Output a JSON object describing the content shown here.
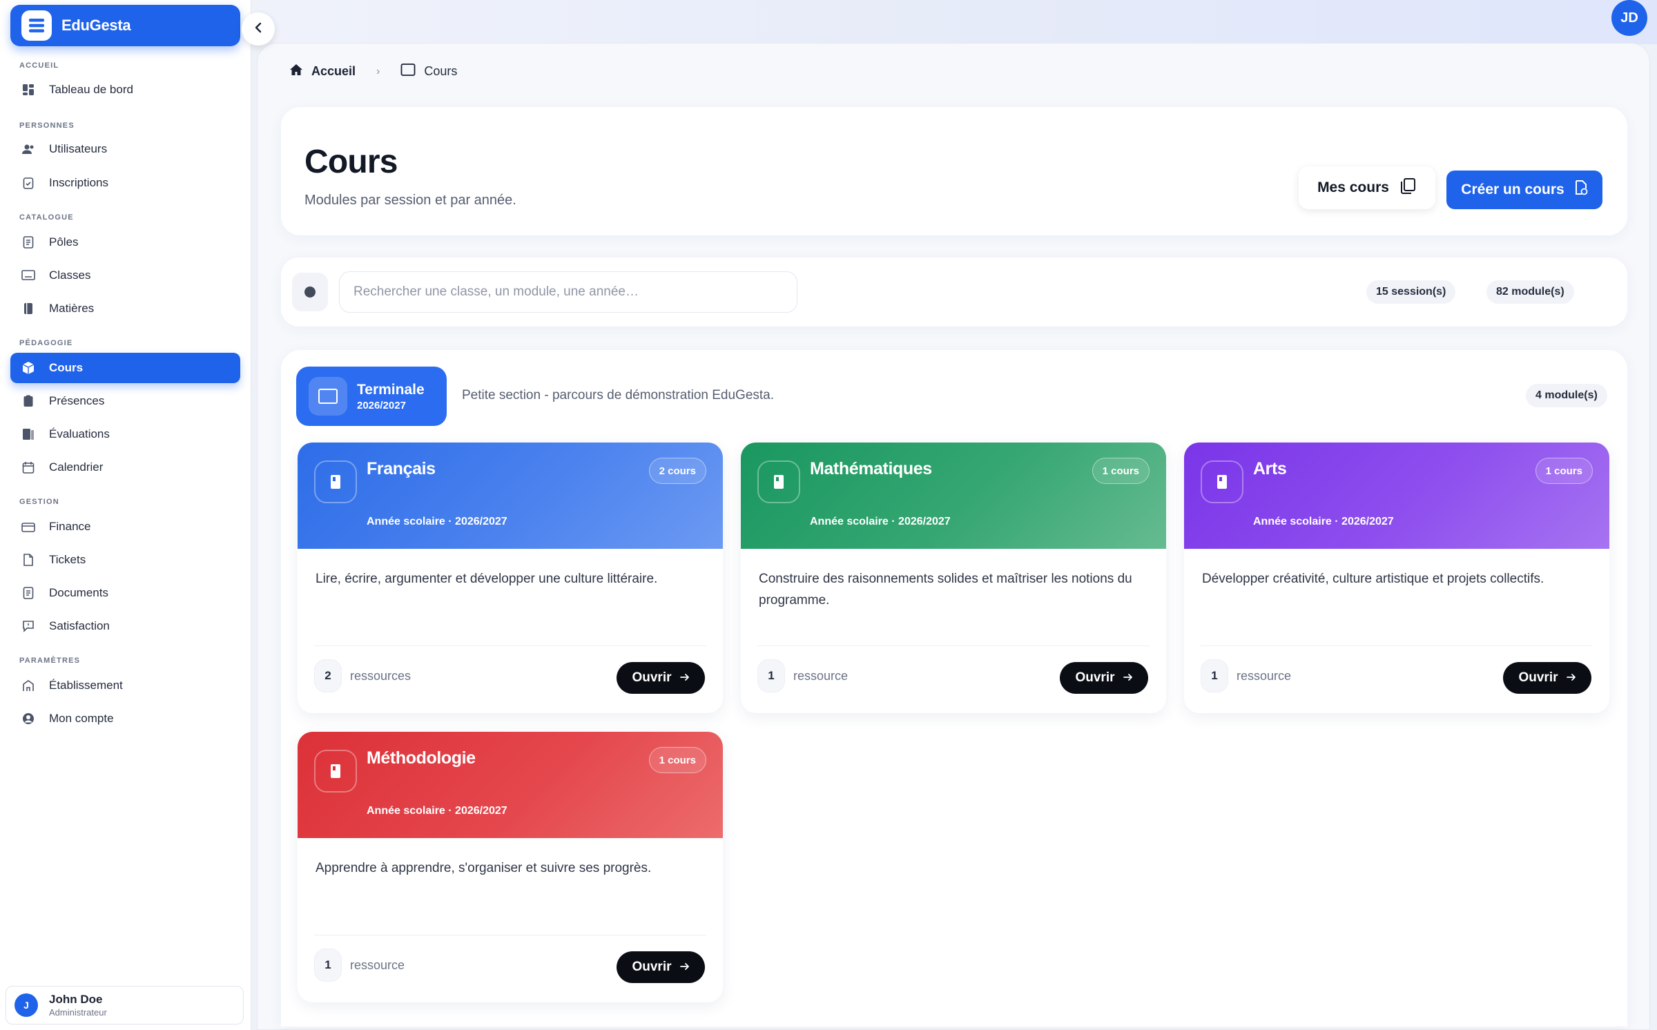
{
  "app": {
    "name": "EduGesta",
    "user_initials": "JD"
  },
  "sidebar": {
    "sections": [
      {
        "label": "ACCUEIL"
      },
      {
        "label": "PERSONNES"
      },
      {
        "label": "CATALOGUE"
      },
      {
        "label": "PÉDAGOGIE"
      },
      {
        "label": "GESTION"
      },
      {
        "label": "PARAMÈTRES"
      }
    ],
    "items": [
      {
        "label": "Tableau de bord",
        "icon": "dashboard-icon"
      },
      {
        "label": "Utilisateurs",
        "icon": "users-icon"
      },
      {
        "label": "Inscriptions",
        "icon": "clipboard-icon"
      },
      {
        "label": "Pôles",
        "icon": "document-icon"
      },
      {
        "label": "Classes",
        "icon": "classroom-icon"
      },
      {
        "label": "Matières",
        "icon": "book-icon"
      },
      {
        "label": "Cours",
        "icon": "courses-icon",
        "active": true
      },
      {
        "label": "Présences",
        "icon": "attendance-icon"
      },
      {
        "label": "Évaluations",
        "icon": "evaluation-icon"
      },
      {
        "label": "Calendrier",
        "icon": "calendar-icon"
      },
      {
        "label": "Finance",
        "icon": "wallet-icon"
      },
      {
        "label": "Tickets",
        "icon": "ticket-icon"
      },
      {
        "label": "Documents",
        "icon": "document-icon"
      },
      {
        "label": "Satisfaction",
        "icon": "feedback-icon"
      },
      {
        "label": "Établissement",
        "icon": "building-icon"
      },
      {
        "label": "Mon compte",
        "icon": "account-icon"
      }
    ],
    "user": {
      "initial": "J",
      "name": "John Doe",
      "role": "Administrateur"
    }
  },
  "breadcrumb": {
    "home": "Accueil",
    "separator": "›",
    "current": "Cours"
  },
  "header": {
    "title": "Cours",
    "subtitle": "Modules par session et par année.",
    "my_courses_label": "Mes cours",
    "create_label": "Créer un cours"
  },
  "search": {
    "placeholder": "Rechercher une classe, un module, une année…",
    "value": "",
    "sessions_count": "15 session(s)",
    "modules_count": "82 module(s)"
  },
  "session": {
    "name": "Terminale",
    "year": "2026/2027",
    "description": "Petite section - parcours de démonstration EduGesta.",
    "module_count": "4 module(s)"
  },
  "modules": [
    {
      "title": "Français",
      "count": "2 cours",
      "year": "Année scolaire · 2026/2027",
      "description": "Lire, écrire, argumenter et développer une culture littéraire.",
      "resources_num": "2",
      "resources_label": "ressources",
      "open_label": "Ouvrir",
      "color": "#2d6de8"
    },
    {
      "title": "Mathématiques",
      "count": "1 cours",
      "year": "Année scolaire · 2026/2027",
      "description": "Construire des raisonnements solides et maîtriser les notions du programme.",
      "resources_num": "1",
      "resources_label": "ressource",
      "open_label": "Ouvrir",
      "color": "#1a9760"
    },
    {
      "title": "Arts",
      "count": "1 cours",
      "year": "Année scolaire · 2026/2027",
      "description": "Développer créativité, culture artistique et projets collectifs.",
      "resources_num": "1",
      "resources_label": "ressource",
      "open_label": "Ouvrir",
      "color": "#7a35e8"
    },
    {
      "title": "Méthodologie",
      "count": "1 cours",
      "year": "Année scolaire · 2026/2027",
      "description": "Apprendre à apprendre, s'organiser et suivre ses progrès.",
      "resources_num": "1",
      "resources_label": "ressource",
      "open_label": "Ouvrir",
      "color": "#dc3138"
    }
  ],
  "colors": {
    "accent": "#1f63ea",
    "dark_button": "#0b0d14"
  }
}
